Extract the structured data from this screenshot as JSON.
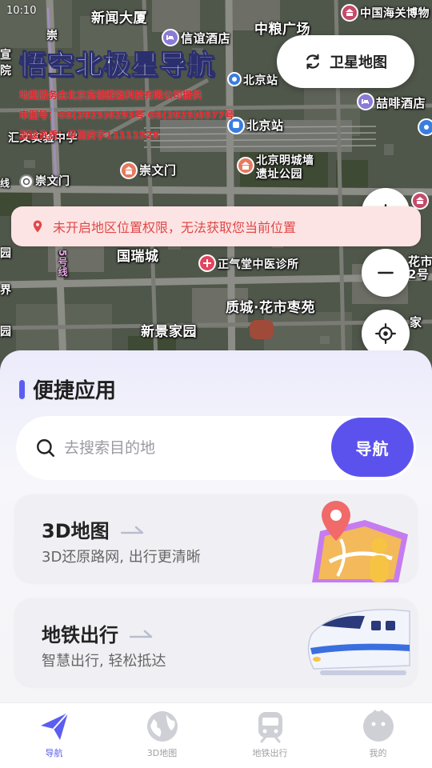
{
  "status": {
    "time": "10:10"
  },
  "map": {
    "brand_title": "悟空北极星导航",
    "licence_lines": [
      "地图服务由北京高德图强科技有限公司提供",
      "审图号：GS(2025)0293号 GS(2025)0577号",
      "测绘资质：甲测资字11111528"
    ],
    "satellite_button": "卫星地图",
    "permission_banner": "未开启地区位置权限，无法获取您当前位置",
    "labels": {
      "news_building": "新闻大厦",
      "zhongliang": "中粮广场",
      "customs_museum": "中国海关博物",
      "xinyi_hotel": "信谊酒店",
      "beijing_station_top": "北京站",
      "beijing_station": "北京站",
      "zhefei_hotel": "喆啡酒店",
      "huiwen_school": "汇文实验中学",
      "chongwenmen_site": "崇文门",
      "chongwenmen_metro": "崇文门",
      "ming_wall_1": "北京明城墙",
      "ming_wall_2": "遗址公园",
      "guoruicheng": "国瑞城",
      "zhengqitang": "正气堂中医诊所",
      "huashi": "质城·花市枣苑",
      "xinjing": "新景家园",
      "line5": "5号线",
      "west_yuan_1": "园",
      "west_jie": "界",
      "west_yuan_2": "园",
      "east_huashi": "花市",
      "east_2hao": "2号",
      "east_jia": "家",
      "east_xian": "线",
      "north_chong": "崇",
      "north_xuan": "宣",
      "north_yuan": "院"
    }
  },
  "sheet": {
    "title": "便捷应用",
    "search_placeholder": "去搜索目的地",
    "navigate_button": "导航",
    "cards": [
      {
        "title": "3D地图",
        "subtitle": "3D还原路网, 出行更清晰"
      },
      {
        "title": "地铁出行",
        "subtitle": "智慧出行, 轻松抵达"
      }
    ]
  },
  "tabs": [
    {
      "label": "导航",
      "icon": "paper-plane-icon",
      "active": true
    },
    {
      "label": "3D地图",
      "icon": "globe-icon",
      "active": false
    },
    {
      "label": "地铁出行",
      "icon": "train-icon",
      "active": false
    },
    {
      "label": "我的",
      "icon": "profile-icon",
      "active": false
    }
  ],
  "colors": {
    "accent": "#5b52ee",
    "banner_bg": "#fde4e4",
    "banner_text": "#e04848",
    "licence_text": "#e8222a"
  }
}
